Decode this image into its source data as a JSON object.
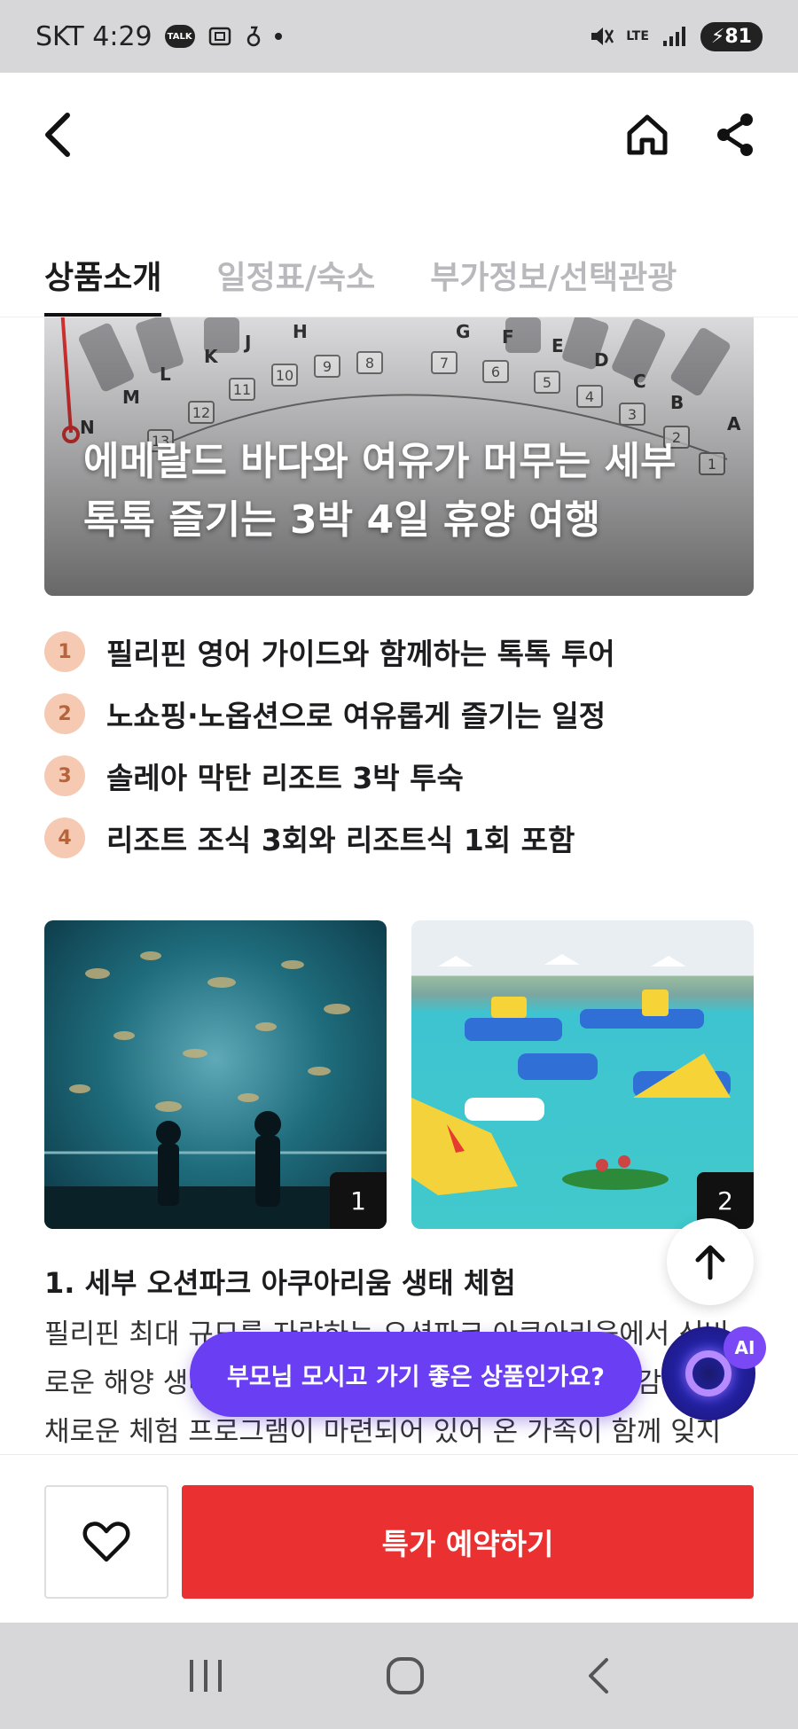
{
  "status_bar": {
    "carrier_time": "SKT 4:29",
    "talk_label": "TALK",
    "network": "LTE",
    "battery": "81"
  },
  "header": {
    "back_icon": "chevron-left-icon",
    "home_icon": "home-icon",
    "share_icon": "share-icon"
  },
  "tabs": [
    {
      "label": "상품소개",
      "active": true
    },
    {
      "label": "일정표/숙소",
      "active": false
    },
    {
      "label": "부가정보/선택관광",
      "active": false
    }
  ],
  "hero": {
    "title_line1": "에메랄드 바다와 여유가 머무는 세부",
    "title_line2": "톡톡 즐기는 3박 4일 휴양 여행",
    "gate_letters": [
      "H",
      "G",
      "F",
      "E",
      "D",
      "C",
      "B",
      "A",
      "J",
      "K",
      "L",
      "M",
      "N"
    ],
    "gate_numbers": [
      "10",
      "9",
      "8",
      "7",
      "6",
      "5",
      "4",
      "3",
      "2",
      "1",
      "11",
      "12",
      "13"
    ]
  },
  "highlights": [
    {
      "icon": "hand-one-icon",
      "num": "1",
      "text": "필리핀 영어 가이드와 함께하는 톡톡 투어"
    },
    {
      "icon": "hand-two-icon",
      "num": "2",
      "text": "노쇼핑·노옵션으로 여유롭게 즐기는 일정"
    },
    {
      "icon": "hand-three-icon",
      "num": "3",
      "text": "솔레아 막탄 리조트 3박 투숙"
    },
    {
      "icon": "hand-four-icon",
      "num": "4",
      "text": "리조트 조식 3회와 리조트식 1회 포함"
    }
  ],
  "photos": [
    {
      "index": "1"
    },
    {
      "index": "2"
    }
  ],
  "section": {
    "title": "1. 세부 오션파크 아쿠아리움 생태 체험",
    "body_line1": "필리핀 최대 규모를 자랑하는 오션파크 아쿠아리움에서 신비",
    "body_line2": "로운 해양 생태계를 관찰하고 다양한 해양 생물과 교감하는 다",
    "body_line3": "채로운 체험 프로그램이 마련되어 있어 온 가족이 함께 잊지"
  },
  "ai": {
    "question": "부모님 모시고 가기 좋은 상품인가요?",
    "badge": "AI"
  },
  "bottom": {
    "wish_icon": "heart-icon",
    "book_label": "특가 예약하기"
  },
  "colors": {
    "accent_red": "#ea3030",
    "ai_purple": "#6a3ef2",
    "status_gray": "#d7d7d9"
  }
}
